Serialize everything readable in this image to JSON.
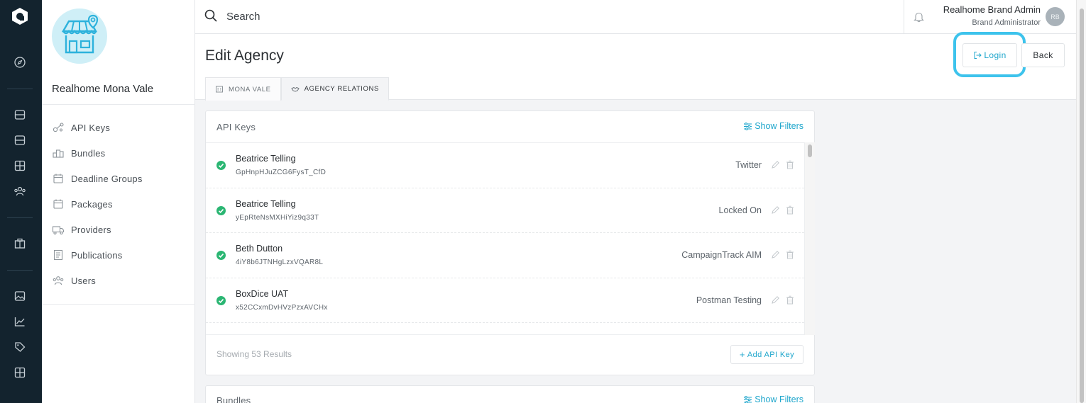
{
  "topbar": {
    "search_placeholder": "Search",
    "user_name": "Realhome Brand Admin",
    "user_role": "Brand Administrator",
    "user_initials": "RB"
  },
  "sidebar": {
    "agency_name": "Realhome Mona Vale",
    "items": [
      {
        "label": "API Keys",
        "icon": "key-icon"
      },
      {
        "label": "Bundles",
        "icon": "bundle-icon"
      },
      {
        "label": "Deadline Groups",
        "icon": "calendar-icon"
      },
      {
        "label": "Packages",
        "icon": "package-icon"
      },
      {
        "label": "Providers",
        "icon": "truck-icon"
      },
      {
        "label": "Publications",
        "icon": "document-icon"
      },
      {
        "label": "Users",
        "icon": "users-icon"
      }
    ]
  },
  "page": {
    "title": "Edit Agency",
    "login_label": "Login",
    "back_label": "Back",
    "tabs": [
      {
        "label": "MONA VALE"
      },
      {
        "label": "AGENCY RELATIONS"
      }
    ]
  },
  "api_keys": {
    "title": "API Keys",
    "filters_label": "Show Filters",
    "rows": [
      {
        "name": "Beatrice Telling",
        "key": "GpHnpHJuZCG6FysT_CfD",
        "provider": "Twitter"
      },
      {
        "name": "Beatrice Telling",
        "key": "yEpRteNsMXHiYiz9q33T",
        "provider": "Locked On"
      },
      {
        "name": "Beth Dutton",
        "key": "4iY8b6JTNHgLzxVQAR8L",
        "provider": "CampaignTrack AIM"
      },
      {
        "name": "BoxDice UAT",
        "key": "x52CCxmDvHVzPzxAVCHx",
        "provider": "Postman Testing"
      }
    ],
    "showing": "Showing 53 Results",
    "add_label": "Add API Key"
  },
  "bundles": {
    "title": "Bundles",
    "filters_label": "Show Filters"
  }
}
